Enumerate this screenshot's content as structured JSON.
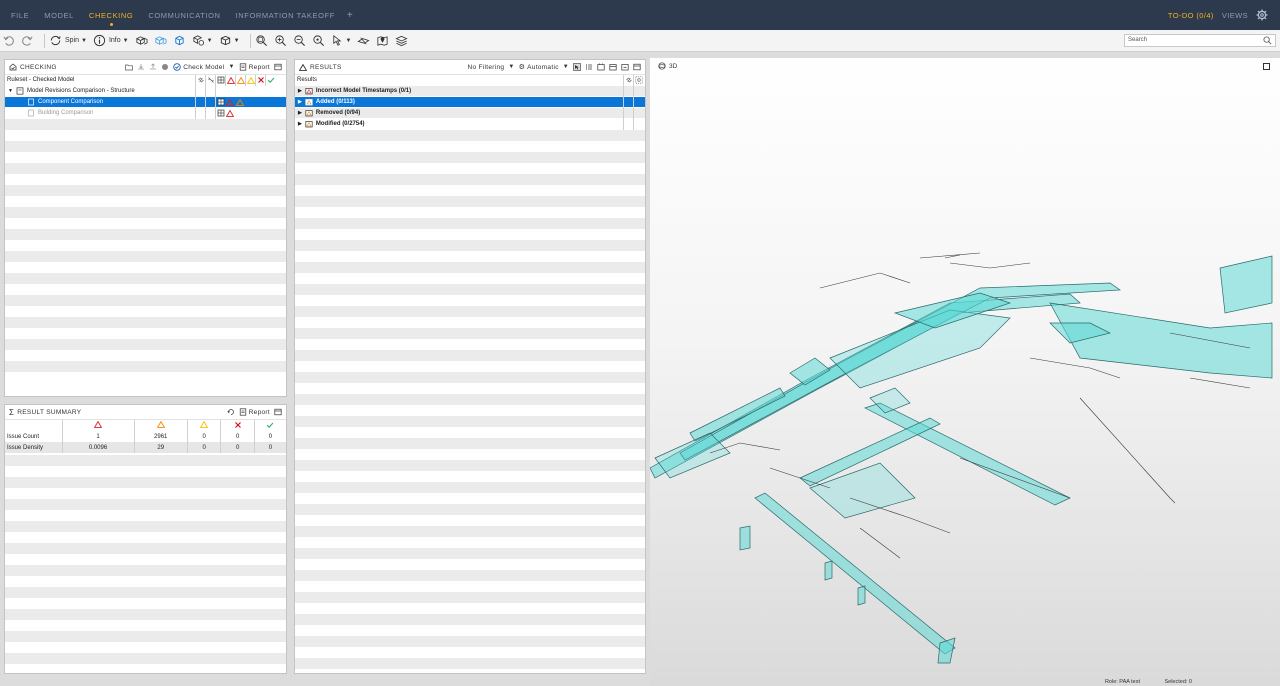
{
  "menu": {
    "items": [
      {
        "label": "FILE",
        "active": false
      },
      {
        "label": "MODEL",
        "active": false
      },
      {
        "label": "CHECKING",
        "active": true
      },
      {
        "label": "COMMUNICATION",
        "active": false
      },
      {
        "label": "INFORMATION TAKEOFF",
        "active": false
      }
    ],
    "plus": "+",
    "todo": "TO-DO (0/4)",
    "views": "VIEWS"
  },
  "toolbar": {
    "spin_label": "Spin",
    "info_label": "Info",
    "search_placeholder": "Search"
  },
  "checking": {
    "title": "CHECKING",
    "check_model_label": "Check Model",
    "report_label": "Report",
    "ruleset_label": "Ruleset - Checked Model",
    "tree": [
      {
        "label": "Model Revisions Comparison - Structure",
        "level": 0,
        "state": "normal"
      },
      {
        "label": "Component Comparison",
        "level": 1,
        "state": "selected"
      },
      {
        "label": "Building Comparison",
        "level": 1,
        "state": "disabled"
      }
    ]
  },
  "summary": {
    "title": "RESULT SUMMARY",
    "report_label": "Report",
    "rows": [
      {
        "label": "Issue Count",
        "values": [
          "1",
          "2961",
          "0",
          "0",
          "0"
        ]
      },
      {
        "label": "Issue Density",
        "values": [
          "0.0096",
          "29",
          "0",
          "0",
          "0"
        ]
      }
    ]
  },
  "results": {
    "title": "RESULTS",
    "filter_label": "No Filtering",
    "auto_label": "Automatic",
    "header_label": "Results",
    "items": [
      {
        "label": "Incorrect Model Timestamps (0/1)",
        "state": "normal"
      },
      {
        "label": "Added (0/113)",
        "state": "selected"
      },
      {
        "label": "Removed (0/94)",
        "state": "normal"
      },
      {
        "label": "Modified (0/2754)",
        "state": "normal"
      }
    ]
  },
  "viewport": {
    "label": "3D",
    "role_label": "Role: PAA test",
    "selected_label": "Selected: 0"
  },
  "colors": {
    "menubar": "#2d3a4e",
    "accent": "#f2b01e",
    "selection": "#0a76d8",
    "critical": "#e02020",
    "moderate": "#f08a00",
    "minor": "#f2c200",
    "rejected": "#d01010",
    "accepted": "#2bb36b",
    "model_cyan": "#5fd9d6"
  }
}
